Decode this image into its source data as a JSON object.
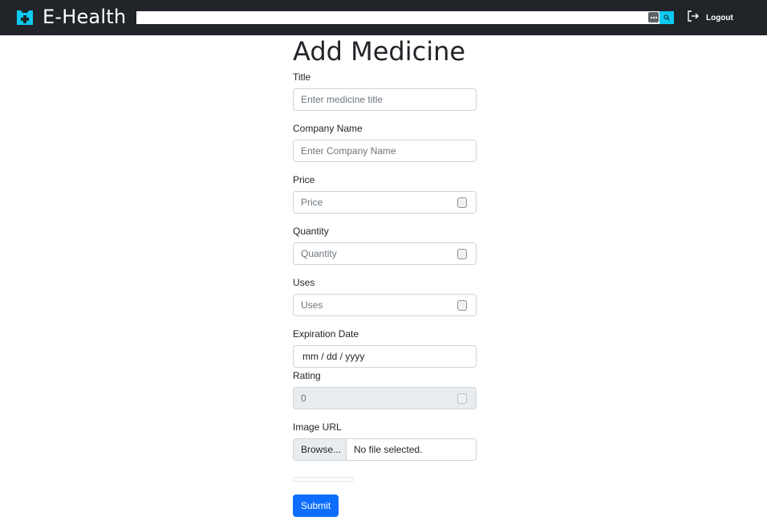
{
  "nav": {
    "brand": "E-Health",
    "brand_icon": "medical-cross-icon",
    "search_icon": "search-icon",
    "logout_label": "Logout",
    "logout_icon": "logout-icon",
    "colors": {
      "navbar": "#212529",
      "search_button": "#0dcaf0",
      "brand_icon": "#0dcaf0"
    }
  },
  "form": {
    "heading": "Add Medicine",
    "title": {
      "label": "Title",
      "placeholder": "Enter medicine title"
    },
    "company": {
      "label": "Company Name",
      "placeholder": "Enter Company Name"
    },
    "price": {
      "label": "Price",
      "placeholder": "Price"
    },
    "quantity": {
      "label": "Quantity",
      "placeholder": "Quantity"
    },
    "uses": {
      "label": "Uses",
      "placeholder": "Uses"
    },
    "expiration": {
      "label": "Expiration Date",
      "value": "mm / dd / yyyy"
    },
    "rating": {
      "label": "Rating",
      "value": "0"
    },
    "image": {
      "label": "Image URL",
      "browse_label": "Browse...",
      "status": "No file selected."
    },
    "submit_label": "Submit",
    "colors": {
      "submit": "#0d6efd",
      "disabled_field": "#e9ecef"
    }
  }
}
